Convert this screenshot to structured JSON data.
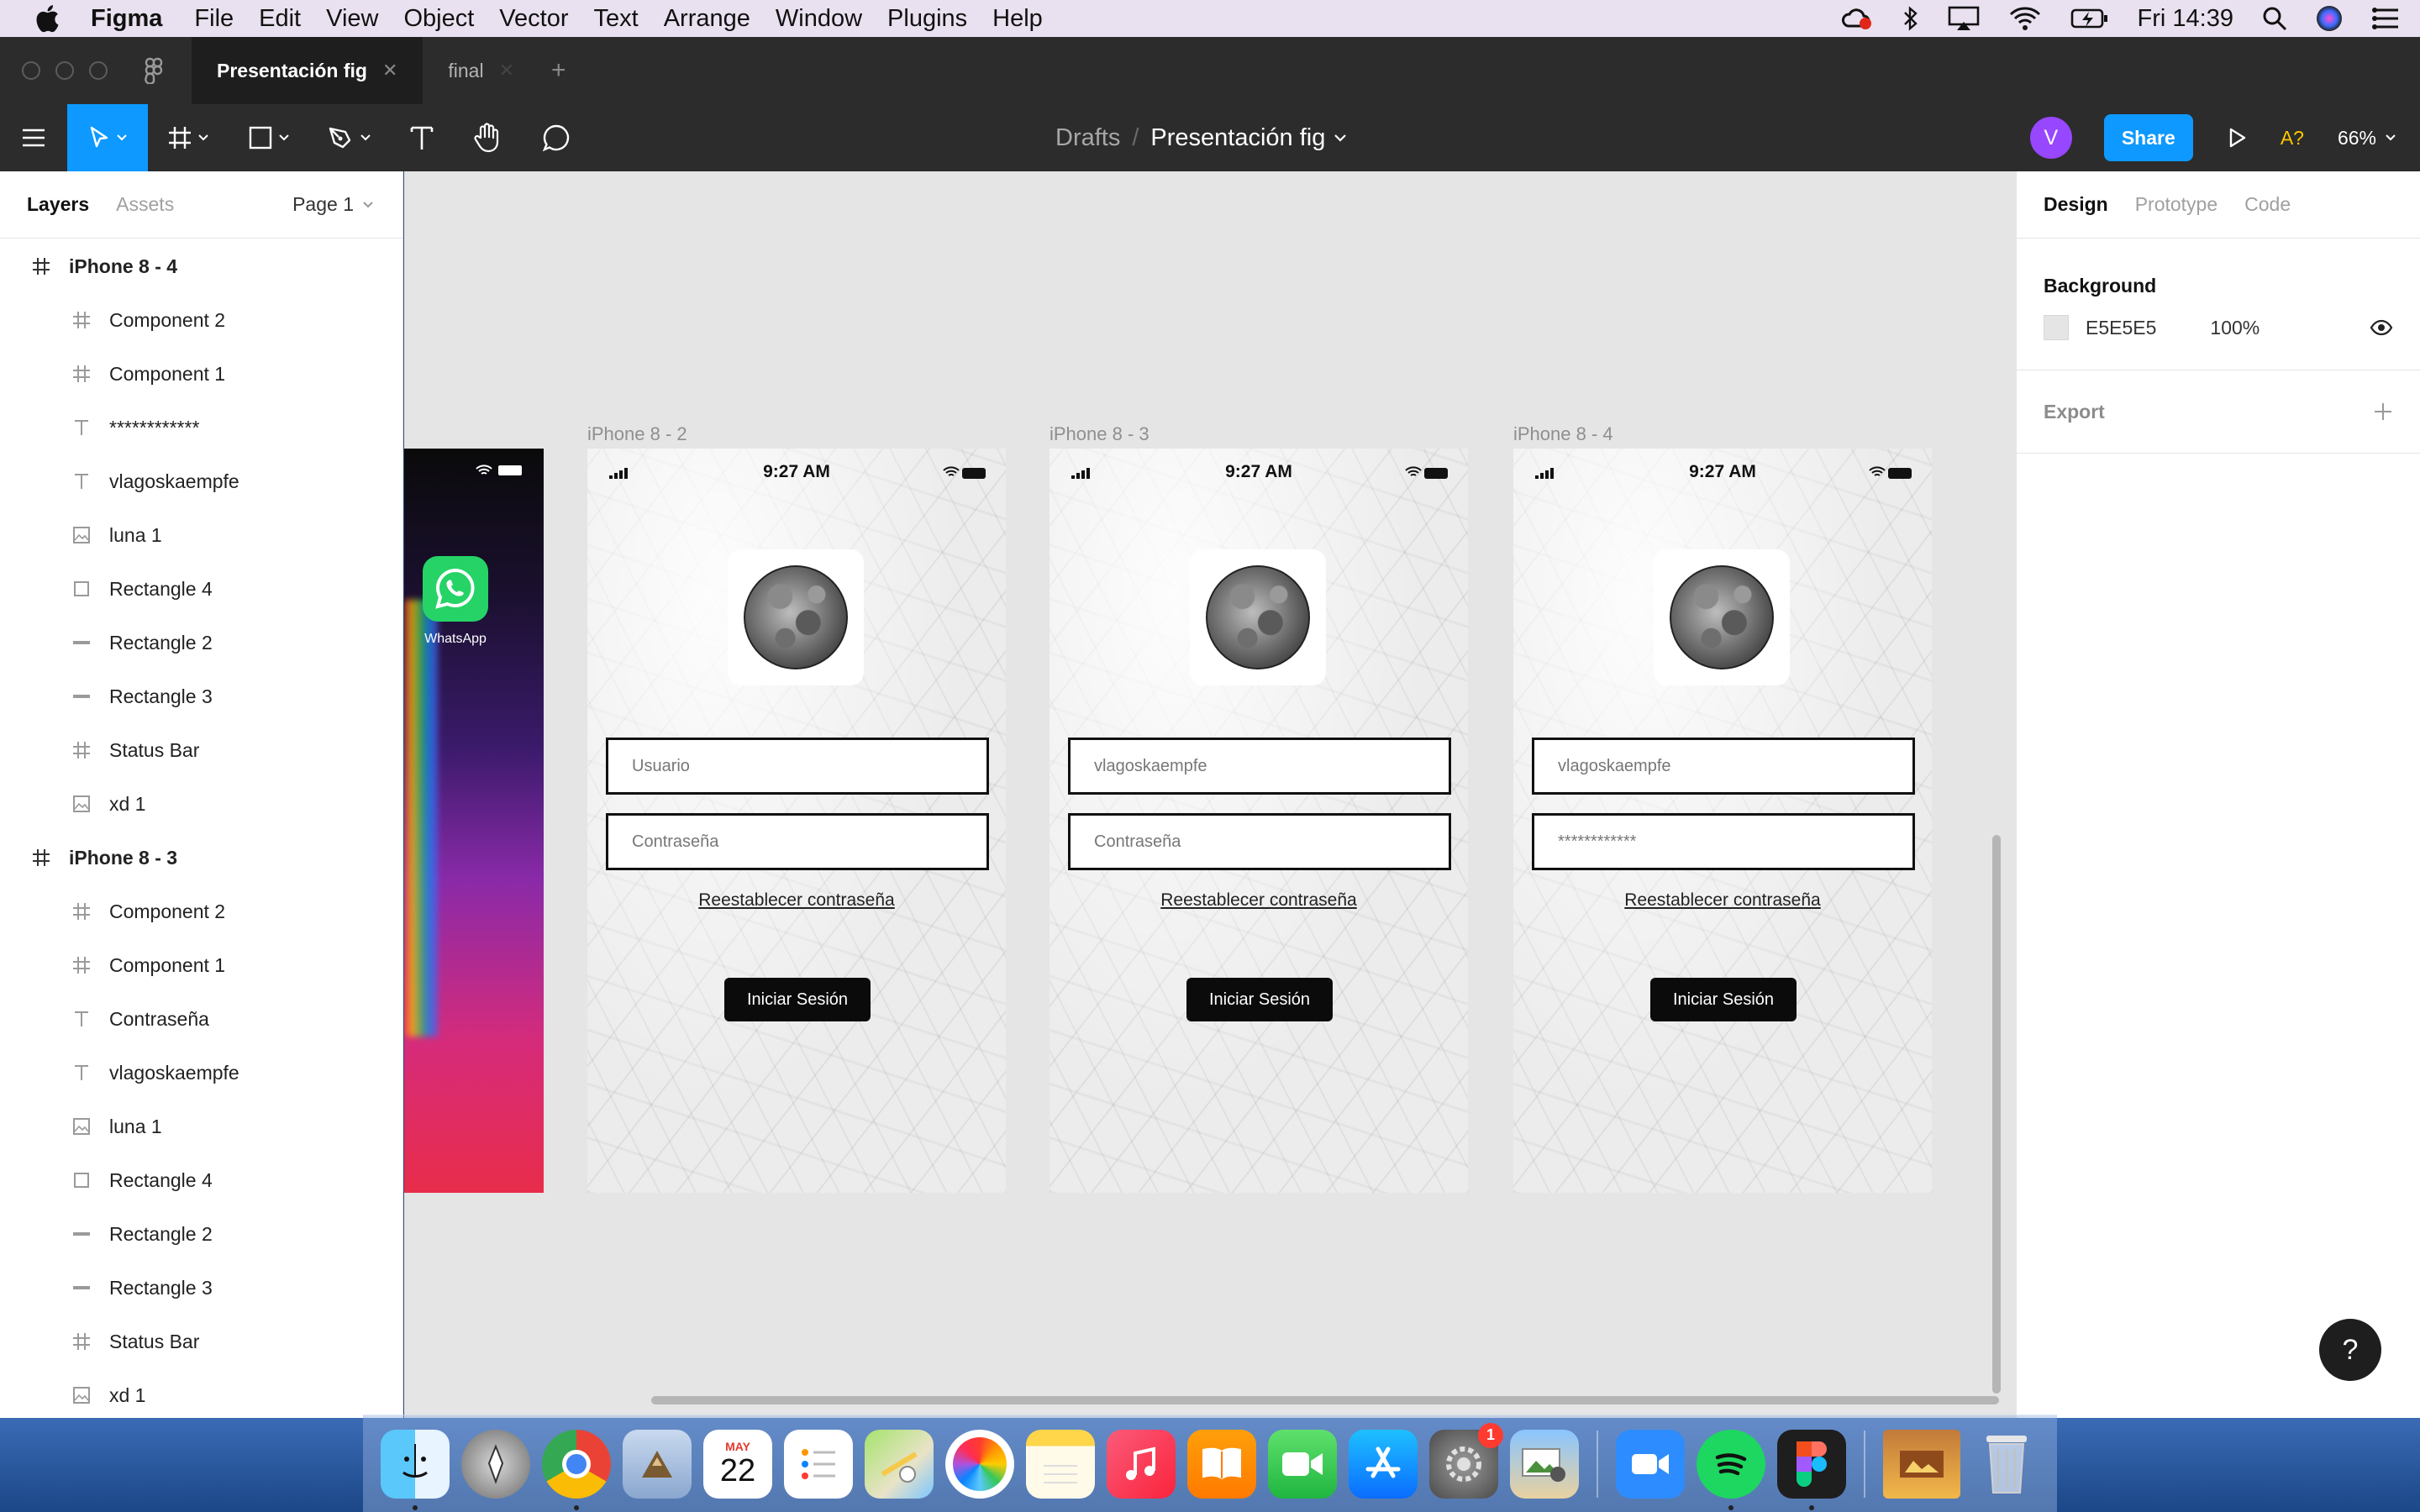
{
  "menubar": {
    "app": "Figma",
    "items": [
      "File",
      "Edit",
      "View",
      "Object",
      "Vector",
      "Text",
      "Arrange",
      "Window",
      "Plugins",
      "Help"
    ],
    "clock": "Fri 14:39",
    "status_icons": [
      "creative-cloud-icon",
      "bluetooth-icon",
      "airplay-icon",
      "wifi-icon",
      "battery-icon",
      "spotlight-icon",
      "siri-icon",
      "control-center-icon"
    ]
  },
  "tabs": [
    {
      "label": "Presentación fig",
      "active": true
    },
    {
      "label": "final",
      "active": false
    }
  ],
  "toolbar": {
    "breadcrumb_root": "Drafts",
    "breadcrumb_sep": "/",
    "file_name": "Presentación fig",
    "avatar_initial": "V",
    "share_label": "Share",
    "assistant_label": "A?",
    "zoom": "66%"
  },
  "left_panel": {
    "tabs": {
      "layers": "Layers",
      "assets": "Assets"
    },
    "page": "Page 1",
    "layers": [
      {
        "name": "iPhone 8 - 4",
        "type": "frame",
        "level": 0
      },
      {
        "name": "Component 2",
        "type": "frame",
        "level": 1
      },
      {
        "name": "Component 1",
        "type": "frame",
        "level": 1
      },
      {
        "name": "************",
        "type": "text",
        "level": 1
      },
      {
        "name": "vlagoskaempfe",
        "type": "text",
        "level": 1
      },
      {
        "name": "luna 1",
        "type": "image",
        "level": 1
      },
      {
        "name": "Rectangle 4",
        "type": "rect",
        "level": 1
      },
      {
        "name": "Rectangle 2",
        "type": "line",
        "level": 1
      },
      {
        "name": "Rectangle 3",
        "type": "line",
        "level": 1
      },
      {
        "name": "Status Bar",
        "type": "frame",
        "level": 1
      },
      {
        "name": "xd 1",
        "type": "image",
        "level": 1
      },
      {
        "name": "iPhone 8 - 3",
        "type": "frame",
        "level": 0
      },
      {
        "name": "Component 2",
        "type": "frame",
        "level": 1
      },
      {
        "name": "Component 1",
        "type": "frame",
        "level": 1
      },
      {
        "name": "Contraseña",
        "type": "text",
        "level": 1
      },
      {
        "name": "vlagoskaempfe",
        "type": "text",
        "level": 1
      },
      {
        "name": "luna 1",
        "type": "image",
        "level": 1
      },
      {
        "name": "Rectangle 4",
        "type": "rect",
        "level": 1
      },
      {
        "name": "Rectangle 2",
        "type": "line",
        "level": 1
      },
      {
        "name": "Rectangle 3",
        "type": "line",
        "level": 1
      },
      {
        "name": "Status Bar",
        "type": "frame",
        "level": 1
      },
      {
        "name": "xd 1",
        "type": "image",
        "level": 1
      }
    ]
  },
  "canvas": {
    "home_app_label": "WhatsApp",
    "frames": [
      {
        "label": "iPhone 8 - 2",
        "time": "9:27 AM",
        "user": "Usuario",
        "password": "Contraseña",
        "reset": "Reestablecer contraseña",
        "login": "Iniciar Sesión"
      },
      {
        "label": "iPhone 8 - 3",
        "time": "9:27 AM",
        "user": "vlagoskaempfe",
        "password": "Contraseña",
        "reset": "Reestablecer contraseña",
        "login": "Iniciar Sesión"
      },
      {
        "label": "iPhone 8 - 4",
        "time": "9:27 AM",
        "user": "vlagoskaempfe",
        "password": "************",
        "reset": "Reestablecer contraseña",
        "login": "Iniciar Sesión"
      }
    ]
  },
  "right_panel": {
    "tabs": [
      "Design",
      "Prototype",
      "Code"
    ],
    "background_title": "Background",
    "background_color": "E5E5E5",
    "background_opacity": "100%",
    "export_title": "Export",
    "help": "?"
  },
  "dock": {
    "badge_count": "1",
    "calendar_month": "MAY",
    "calendar_day": "22"
  }
}
